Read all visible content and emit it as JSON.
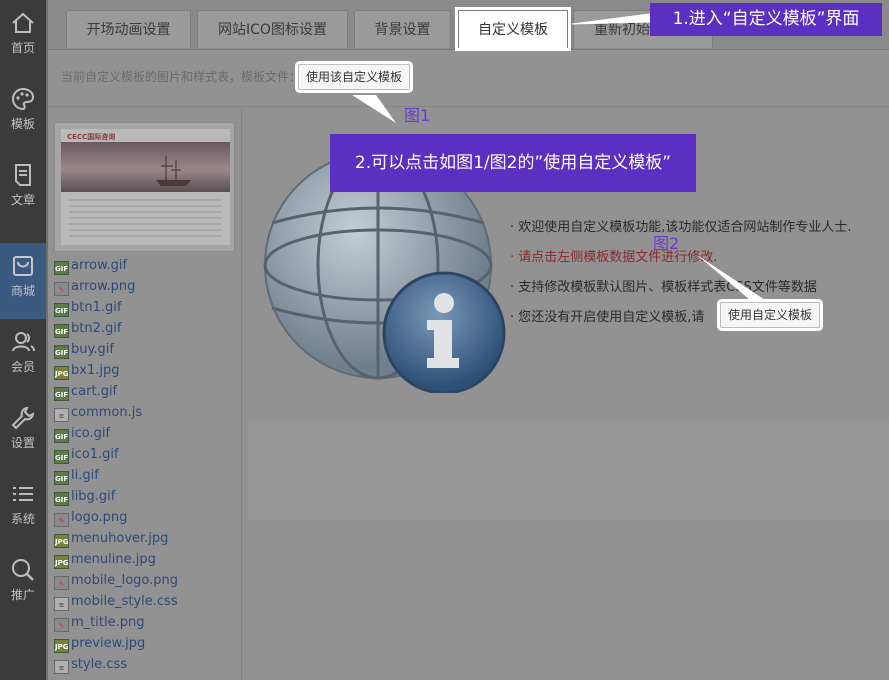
{
  "sidebar": {
    "items": [
      {
        "label": "首页",
        "icon": "home-icon"
      },
      {
        "label": "模板",
        "icon": "palette-icon"
      },
      {
        "label": "文章",
        "icon": "document-icon"
      },
      {
        "label": "商城",
        "icon": "bag-icon"
      },
      {
        "label": "会员",
        "icon": "users-icon"
      },
      {
        "label": "设置",
        "icon": "wrench-icon"
      },
      {
        "label": "系统",
        "icon": "list-icon"
      },
      {
        "label": "推广",
        "icon": "search-icon"
      }
    ],
    "active_index": 3
  },
  "tabs": [
    {
      "label": "开场动画设置"
    },
    {
      "label": "网站ICO图标设置"
    },
    {
      "label": "背景设置"
    },
    {
      "label": "自定义模板"
    },
    {
      "label": "重新初始化模板"
    }
  ],
  "subbar": {
    "text": "当前自定义模板的图片和样式表，模板文件：",
    "button_label": "使用该自定义模板"
  },
  "preview": {
    "logo_text": "CECC国际咨询"
  },
  "files": [
    {
      "name": "arrow.gif",
      "type": "gif"
    },
    {
      "name": "arrow.png",
      "type": "png"
    },
    {
      "name": "btn1.gif",
      "type": "gif"
    },
    {
      "name": "btn2.gif",
      "type": "gif"
    },
    {
      "name": "buy.gif",
      "type": "gif"
    },
    {
      "name": "bx1.jpg",
      "type": "jpg"
    },
    {
      "name": "cart.gif",
      "type": "gif"
    },
    {
      "name": "common.js",
      "type": "txt"
    },
    {
      "name": "ico.gif",
      "type": "gif"
    },
    {
      "name": "ico1.gif",
      "type": "gif"
    },
    {
      "name": "li.gif",
      "type": "gif"
    },
    {
      "name": "libg.gif",
      "type": "gif"
    },
    {
      "name": "logo.png",
      "type": "png"
    },
    {
      "name": "menuhover.jpg",
      "type": "jpg"
    },
    {
      "name": "menuline.jpg",
      "type": "jpg"
    },
    {
      "name": "mobile_logo.png",
      "type": "png"
    },
    {
      "name": "mobile_style.css",
      "type": "txt"
    },
    {
      "name": "m_title.png",
      "type": "png"
    },
    {
      "name": "preview.jpg",
      "type": "jpg"
    },
    {
      "name": "style.css",
      "type": "txt"
    }
  ],
  "info": {
    "line1": "· 欢迎使用自定义模板功能,该功能仅适合网站制作专业人士.",
    "line2": "· 请点击左侧模板数据文件进行修改.",
    "line3": "· 支持修改模板默认图片、模板样式表CSS文件等数据",
    "line4": "· 您还没有开启使用自定义模板,请",
    "button_label": "使用自定义模板"
  },
  "annotations": {
    "step1": "1.进入“自定义模板”界面",
    "step2": "2.可以点击如图1/图2的”使用自定义模板”",
    "fig1": "图1",
    "fig2": "图2",
    "color": "#5a2fc2"
  }
}
